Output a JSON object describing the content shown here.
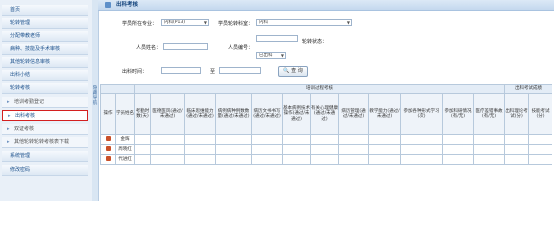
{
  "nav": {
    "items": [
      {
        "label": "首页",
        "sub": false,
        "active": false
      },
      {
        "label": "轮转管理",
        "sub": false,
        "active": false
      },
      {
        "label": "分配带教老师",
        "sub": false,
        "active": false
      },
      {
        "label": "病种、技能及手术审核",
        "sub": false,
        "active": false
      },
      {
        "label": "其他轮转信息审核",
        "sub": false,
        "active": false
      },
      {
        "label": "出科小结",
        "sub": false,
        "active": false
      },
      {
        "label": "轮转考核",
        "sub": false,
        "active": false
      },
      {
        "label": "培训考勤登记",
        "sub": true,
        "active": false
      },
      {
        "label": "出科考核",
        "sub": true,
        "active": true
      },
      {
        "label": "双证考核",
        "sub": true,
        "active": false
      },
      {
        "label": "其他轮转轮转考核表下载",
        "sub": true,
        "active": false
      },
      {
        "label": "系统管理",
        "sub": false,
        "active": false
      },
      {
        "label": "修改密码",
        "sub": false,
        "active": false
      }
    ],
    "collapse_label": "隐藏导航"
  },
  "header": {
    "title": "出科考核"
  },
  "filters": {
    "dept_label": "学员所在专业：",
    "dept_value": "内科(P13)",
    "rotation_label": "学员轮转科室：",
    "rotation_value": "内科",
    "name_label": "人员姓名：",
    "name_value": "",
    "id_label": "人员编号：",
    "id_value": "",
    "status_label": "轮转状态：",
    "status_value": "已出科",
    "time_label": "出科时间：",
    "time_from": "",
    "to_label": "至",
    "time_to": "",
    "query_label": "查 询"
  },
  "table": {
    "section1": "培训过程考核",
    "section2": "出科考试成绩",
    "columns": [
      "操作",
      "学员姓名",
      "考勤时数(天)",
      "医德医风(通过/未通过)",
      "临床思维能力(通过/未通过)",
      "病例病种例数数量(通过/未通过)",
      "病历文书书写(通过/未通过)",
      "基本病例技术操作(通过/未通过)",
      "有关心理健康(通过/未通过)",
      "病历管理(通过/未通过)",
      "教学能力(通过/未通过)",
      "参加各种形式学习(次)",
      "参加科研情况(有/无)",
      "医疗差错事故(有/无)",
      "出科理论考试(分)",
      "技能考试(分)"
    ],
    "rows": [
      {
        "name": "金辉"
      },
      {
        "name": "周晓红"
      },
      {
        "name": "代进红"
      }
    ]
  }
}
